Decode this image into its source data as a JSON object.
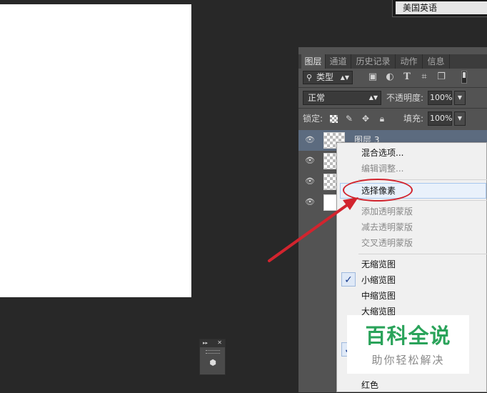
{
  "language_selector": {
    "value": "美国英语"
  },
  "layers_panel": {
    "tabs": [
      {
        "label": "图层"
      },
      {
        "label": "通道"
      },
      {
        "label": "历史记录"
      },
      {
        "label": "动作"
      },
      {
        "label": "信息"
      }
    ],
    "filter": {
      "label": "类型"
    },
    "blend_mode": "正常",
    "opacity_label": "不透明度:",
    "opacity_value": "100%",
    "lock_label": "锁定:",
    "fill_label": "填充:",
    "fill_value": "100%",
    "layers": [
      {
        "name": "图层 3"
      },
      {
        "name": ""
      },
      {
        "name": ""
      },
      {
        "name": ""
      }
    ]
  },
  "context_menu": {
    "items": [
      {
        "label": "混合选项..."
      },
      {
        "label": "编辑调整..."
      },
      {
        "label": "选择像素"
      },
      {
        "label": "添加透明蒙版"
      },
      {
        "label": "减去透明蒙版"
      },
      {
        "label": "交叉透明蒙版"
      },
      {
        "label": "无缩览图"
      },
      {
        "label": "小缩览图"
      },
      {
        "label": "中缩览图"
      },
      {
        "label": "大缩览图"
      },
      {
        "label": "红色"
      }
    ]
  },
  "watermark": {
    "title": "百科全说",
    "subtitle": "助你轻松解决"
  },
  "colors": {
    "workspace": "#282828",
    "panel": "#535353",
    "selected_layer": "#5c6b7f",
    "annotation_red": "#d2242e",
    "watermark_green": "#2aa35a"
  }
}
